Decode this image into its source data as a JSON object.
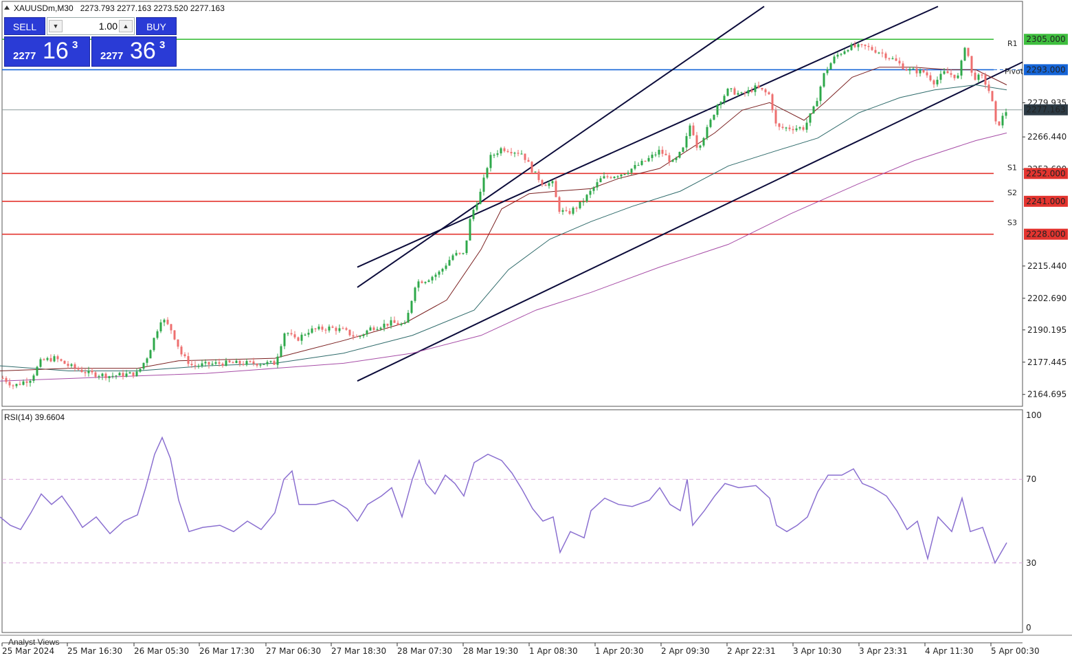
{
  "header": {
    "symbol": "XAUUSDm,M30",
    "ohlc": "2273.793 2277.163 2273.520 2277.163"
  },
  "trade_panel": {
    "sell_label": "SELL",
    "buy_label": "BUY",
    "lot": "1.00",
    "sell_quote": {
      "small": "2277",
      "big": "16",
      "sup": "3"
    },
    "buy_quote": {
      "small": "2277",
      "big": "36",
      "sup": "3"
    }
  },
  "price_axis": {
    "ticks": [
      "2279.935",
      "2266.440",
      "2253.690",
      "2215.440",
      "2202.690",
      "2190.195",
      "2177.445",
      "2164.695"
    ]
  },
  "price_tags": [
    {
      "label": "2305.000",
      "value": 2305.0,
      "color": "#3fbf3f"
    },
    {
      "label": "2293.000",
      "value": 2293.0,
      "color": "#1565d8"
    },
    {
      "label": "2277.163",
      "value": 2277.163,
      "color": "#2c3a44"
    },
    {
      "label": "2252.000",
      "value": 2252.0,
      "color": "#e3342f"
    },
    {
      "label": "2241.000",
      "value": 2241.0,
      "color": "#e3342f"
    },
    {
      "label": "2228.000",
      "value": 2228.0,
      "color": "#e3342f"
    }
  ],
  "level_labels": {
    "r1": "R1",
    "pivot": "Pivot",
    "s1": "S1",
    "s2": "S2",
    "s3": "S3"
  },
  "colors": {
    "bull": "#2ea84a",
    "bear": "#ee6f6f",
    "ema_fast": "#7a1f1f",
    "ema_mid": "#2e6a6a",
    "ema_slow": "#a64ca6",
    "channel": "#0b0b3a",
    "rsi": "#8a6fd0"
  },
  "rsi": {
    "label": "RSI(14) 39.6604",
    "levels_axis": [
      "100",
      "70",
      "30",
      "0"
    ]
  },
  "analyst_views": "Analyst Views",
  "time_axis": [
    "25 Mar 2024",
    "25 Mar 16:30",
    "26 Mar 05:30",
    "26 Mar 17:30",
    "27 Mar 06:30",
    "27 Mar 18:30",
    "28 Mar 07:30",
    "28 Mar 19:30",
    "1 Apr 08:30",
    "1 Apr 20:30",
    "2 Apr 09:30",
    "2 Apr 22:31",
    "3 Apr 10:30",
    "3 Apr 23:31",
    "4 Apr 11:30",
    "5 Apr 00:30"
  ],
  "chart_data": {
    "type": "line",
    "series_path": [
      [
        0,
        2172
      ],
      [
        20,
        2168
      ],
      [
        45,
        2171
      ],
      [
        60,
        2178
      ],
      [
        80,
        2179
      ],
      [
        100,
        2176
      ],
      [
        130,
        2173
      ],
      [
        160,
        2172
      ],
      [
        200,
        2173
      ],
      [
        215,
        2180
      ],
      [
        235,
        2195
      ],
      [
        250,
        2190
      ],
      [
        265,
        2180
      ],
      [
        280,
        2176
      ],
      [
        320,
        2177
      ],
      [
        360,
        2177
      ],
      [
        400,
        2177
      ],
      [
        415,
        2190
      ],
      [
        430,
        2186
      ],
      [
        450,
        2190
      ],
      [
        480,
        2191
      ],
      [
        500,
        2190
      ],
      [
        520,
        2187
      ],
      [
        540,
        2191
      ],
      [
        570,
        2193
      ],
      [
        590,
        2192
      ],
      [
        605,
        2209
      ],
      [
        620,
        2210
      ],
      [
        640,
        2213
      ],
      [
        660,
        2220
      ],
      [
        675,
        2220
      ],
      [
        685,
        2235
      ],
      [
        700,
        2245
      ],
      [
        712,
        2258
      ],
      [
        730,
        2262
      ],
      [
        745,
        2261
      ],
      [
        760,
        2260
      ],
      [
        775,
        2253
      ],
      [
        790,
        2248
      ],
      [
        805,
        2248
      ],
      [
        812,
        2238
      ],
      [
        825,
        2236
      ],
      [
        845,
        2240
      ],
      [
        860,
        2245
      ],
      [
        875,
        2250
      ],
      [
        890,
        2251
      ],
      [
        905,
        2252
      ],
      [
        920,
        2254
      ],
      [
        940,
        2257
      ],
      [
        960,
        2261
      ],
      [
        980,
        2256
      ],
      [
        995,
        2262
      ],
      [
        1005,
        2272
      ],
      [
        1015,
        2262
      ],
      [
        1030,
        2270
      ],
      [
        1045,
        2280
      ],
      [
        1060,
        2285
      ],
      [
        1080,
        2283
      ],
      [
        1100,
        2286
      ],
      [
        1120,
        2283
      ],
      [
        1130,
        2270
      ],
      [
        1150,
        2270
      ],
      [
        1170,
        2270
      ],
      [
        1185,
        2278
      ],
      [
        1200,
        2292
      ],
      [
        1215,
        2298
      ],
      [
        1235,
        2302
      ],
      [
        1260,
        2302
      ],
      [
        1280,
        2300
      ],
      [
        1300,
        2297
      ],
      [
        1320,
        2293
      ],
      [
        1345,
        2292
      ],
      [
        1360,
        2288
      ],
      [
        1375,
        2292
      ],
      [
        1395,
        2290
      ],
      [
        1405,
        2304
      ],
      [
        1415,
        2290
      ],
      [
        1430,
        2290
      ],
      [
        1442,
        2283
      ],
      [
        1450,
        2270
      ],
      [
        1465,
        2277
      ]
    ],
    "ema_fast_path": [
      [
        0,
        2174
      ],
      [
        100,
        2175
      ],
      [
        200,
        2175
      ],
      [
        260,
        2178
      ],
      [
        400,
        2179
      ],
      [
        500,
        2186
      ],
      [
        590,
        2193
      ],
      [
        650,
        2202
      ],
      [
        700,
        2222
      ],
      [
        730,
        2238
      ],
      [
        770,
        2244
      ],
      [
        810,
        2245
      ],
      [
        860,
        2246
      ],
      [
        900,
        2250
      ],
      [
        960,
        2254
      ],
      [
        1000,
        2261
      ],
      [
        1040,
        2268
      ],
      [
        1080,
        2277
      ],
      [
        1120,
        2280
      ],
      [
        1170,
        2273
      ],
      [
        1200,
        2280
      ],
      [
        1240,
        2290
      ],
      [
        1280,
        2294
      ],
      [
        1330,
        2294
      ],
      [
        1380,
        2293
      ],
      [
        1420,
        2293
      ],
      [
        1465,
        2287
      ]
    ],
    "ema_mid_path": [
      [
        0,
        2176
      ],
      [
        100,
        2174
      ],
      [
        200,
        2174
      ],
      [
        300,
        2176
      ],
      [
        400,
        2177
      ],
      [
        500,
        2181
      ],
      [
        600,
        2188
      ],
      [
        690,
        2198
      ],
      [
        740,
        2214
      ],
      [
        800,
        2226
      ],
      [
        860,
        2233
      ],
      [
        920,
        2239
      ],
      [
        990,
        2245
      ],
      [
        1060,
        2255
      ],
      [
        1130,
        2261
      ],
      [
        1190,
        2266
      ],
      [
        1250,
        2276
      ],
      [
        1310,
        2282
      ],
      [
        1360,
        2285
      ],
      [
        1420,
        2287
      ],
      [
        1465,
        2285
      ]
    ],
    "ema_slow_path": [
      [
        0,
        2170
      ],
      [
        200,
        2172
      ],
      [
        300,
        2173
      ],
      [
        400,
        2175
      ],
      [
        500,
        2177
      ],
      [
        600,
        2181
      ],
      [
        700,
        2188
      ],
      [
        780,
        2198
      ],
      [
        860,
        2205
      ],
      [
        960,
        2215
      ],
      [
        1060,
        2224
      ],
      [
        1150,
        2236
      ],
      [
        1250,
        2248
      ],
      [
        1330,
        2257
      ],
      [
        1420,
        2265
      ],
      [
        1465,
        2268
      ]
    ],
    "rsi_path": [
      [
        0,
        52
      ],
      [
        15,
        48
      ],
      [
        30,
        46
      ],
      [
        45,
        54
      ],
      [
        60,
        63
      ],
      [
        75,
        58
      ],
      [
        90,
        62
      ],
      [
        105,
        55
      ],
      [
        120,
        47
      ],
      [
        140,
        52
      ],
      [
        160,
        44
      ],
      [
        180,
        50
      ],
      [
        200,
        53
      ],
      [
        212,
        66
      ],
      [
        225,
        82
      ],
      [
        236,
        90
      ],
      [
        248,
        80
      ],
      [
        260,
        60
      ],
      [
        275,
        45
      ],
      [
        295,
        47
      ],
      [
        320,
        48
      ],
      [
        340,
        45
      ],
      [
        360,
        50
      ],
      [
        380,
        46
      ],
      [
        400,
        54
      ],
      [
        413,
        70
      ],
      [
        425,
        74
      ],
      [
        435,
        58
      ],
      [
        460,
        58
      ],
      [
        485,
        60
      ],
      [
        505,
        56
      ],
      [
        520,
        50
      ],
      [
        535,
        58
      ],
      [
        555,
        62
      ],
      [
        570,
        66
      ],
      [
        585,
        52
      ],
      [
        600,
        70
      ],
      [
        610,
        79
      ],
      [
        620,
        68
      ],
      [
        633,
        63
      ],
      [
        648,
        72
      ],
      [
        662,
        68
      ],
      [
        675,
        62
      ],
      [
        690,
        78
      ],
      [
        710,
        82
      ],
      [
        730,
        79
      ],
      [
        745,
        73
      ],
      [
        760,
        65
      ],
      [
        775,
        56
      ],
      [
        790,
        50
      ],
      [
        805,
        52
      ],
      [
        815,
        35
      ],
      [
        830,
        45
      ],
      [
        850,
        42
      ],
      [
        860,
        55
      ],
      [
        880,
        61
      ],
      [
        900,
        58
      ],
      [
        920,
        57
      ],
      [
        945,
        60
      ],
      [
        960,
        66
      ],
      [
        975,
        58
      ],
      [
        990,
        55
      ],
      [
        1000,
        70
      ],
      [
        1008,
        48
      ],
      [
        1025,
        55
      ],
      [
        1040,
        62
      ],
      [
        1055,
        68
      ],
      [
        1075,
        66
      ],
      [
        1100,
        67
      ],
      [
        1120,
        61
      ],
      [
        1130,
        48
      ],
      [
        1145,
        45
      ],
      [
        1160,
        48
      ],
      [
        1175,
        52
      ],
      [
        1190,
        64
      ],
      [
        1205,
        72
      ],
      [
        1225,
        72
      ],
      [
        1242,
        75
      ],
      [
        1255,
        68
      ],
      [
        1270,
        66
      ],
      [
        1290,
        62
      ],
      [
        1305,
        55
      ],
      [
        1320,
        46
      ],
      [
        1335,
        50
      ],
      [
        1350,
        32
      ],
      [
        1365,
        52
      ],
      [
        1385,
        45
      ],
      [
        1400,
        61
      ],
      [
        1412,
        45
      ],
      [
        1430,
        47
      ],
      [
        1448,
        30
      ],
      [
        1465,
        39.66
      ]
    ],
    "channel_lines": [
      {
        "from": [
          520,
          2207
        ],
        "to": [
          1112,
          2318
        ]
      },
      {
        "from": [
          520,
          2215
        ],
        "to": [
          1365,
          2318
        ]
      },
      {
        "from": [
          520,
          2170
        ],
        "to": [
          1488,
          2296
        ]
      }
    ],
    "ylim": [
      2160,
      2320
    ],
    "rsi_ylim": [
      0,
      100
    ]
  }
}
